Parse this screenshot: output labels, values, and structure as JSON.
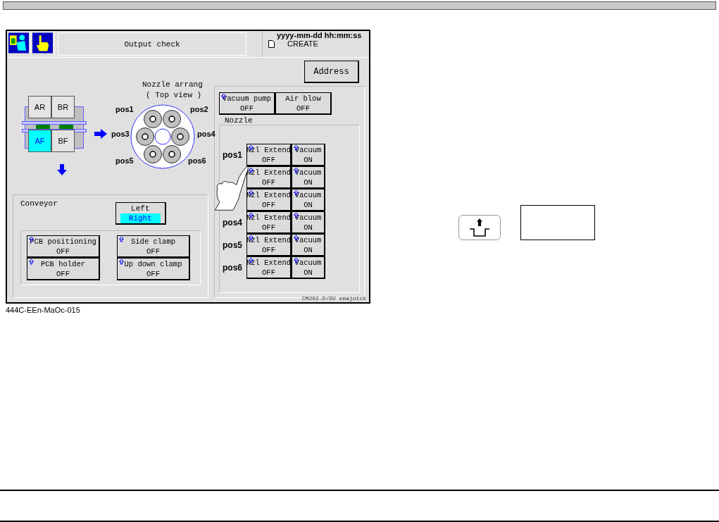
{
  "header": {
    "title": "Output check",
    "datetime": "yyyy-mm-dd  hh:mm:ss",
    "mode": "CREATE"
  },
  "address_button": "Address",
  "lanes": [
    {
      "label": "AR",
      "selected": false
    },
    {
      "label": "BR",
      "selected": false
    },
    {
      "label": "AF",
      "selected": true
    },
    {
      "label": "BF",
      "selected": false
    }
  ],
  "nozzle_arrangement": {
    "title": "Nozzle arrang",
    "subtitle": "(  Top view  )",
    "positions": [
      "pos1",
      "pos2",
      "pos3",
      "pos4",
      "pos5",
      "pos6"
    ]
  },
  "conveyor": {
    "label": "Conveyor",
    "options": [
      {
        "label": "Left",
        "selected": false
      },
      {
        "label": "Right",
        "selected": true
      }
    ],
    "switches": [
      {
        "label": "PCB positioning",
        "value": "OFF",
        "indicator": true
      },
      {
        "label": "Side clamp",
        "value": "OFF",
        "indicator": true
      },
      {
        "label": "PCB holder",
        "value": "OFF",
        "indicator": true
      },
      {
        "label": "Up down clamp",
        "value": "OFF",
        "indicator": true
      }
    ]
  },
  "pumps": [
    {
      "label": "Vacuum pump",
      "value": "OFF",
      "indicator": true
    },
    {
      "label": "Air blow",
      "value": "OFF",
      "indicator": false
    }
  ],
  "nozzle": {
    "title": "Nozzle",
    "rows": [
      {
        "label": "pos1",
        "extend": {
          "label": "Nzl Extend",
          "value": "OFF"
        },
        "vacuum": {
          "label": "Vacuum",
          "value": "ON"
        }
      },
      {
        "extend": {
          "label": "Nzl Extend",
          "value": "OFF"
        },
        "vacuum": {
          "label": "Vacuum",
          "value": "ON"
        }
      },
      {
        "extend": {
          "label": "Nzl Extend",
          "value": "OFF"
        },
        "vacuum": {
          "label": "Vacuum",
          "value": "ON"
        }
      },
      {
        "label": "pos4",
        "extend": {
          "label": "Nzl Extend",
          "value": "OFF"
        },
        "vacuum": {
          "label": "Vacuum",
          "value": "ON"
        }
      },
      {
        "label": "pos5",
        "extend": {
          "label": "Nzl Extend",
          "value": "OFF"
        },
        "vacuum": {
          "label": "Vacuum",
          "value": "ON"
        }
      },
      {
        "label": "pos6",
        "extend": {
          "label": "Nzl Extend",
          "value": "OFF"
        },
        "vacuum": {
          "label": "Vacuum",
          "value": "ON"
        }
      }
    ]
  },
  "footer": "CM202-D/DU   emajotck",
  "caption": "444C-EEn-MaOc-015"
}
